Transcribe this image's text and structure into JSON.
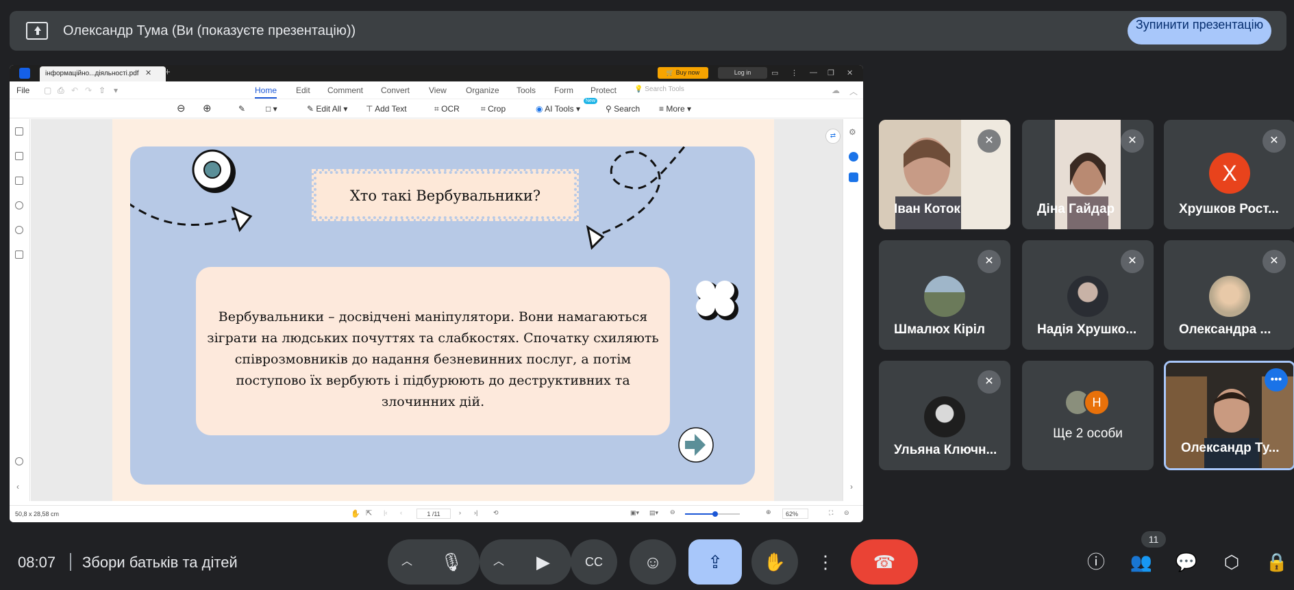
{
  "banner": {
    "title": "Олександр Тума (Ви (показуєте презентацію))",
    "stop_button": "Зупинити презентацію"
  },
  "pdf": {
    "tab_title": "інформаційно...діяльності.pdf",
    "buy_now": "Buy now",
    "log_in": "Log in",
    "file_menu": "File",
    "menu": [
      "Home",
      "Edit",
      "Comment",
      "Convert",
      "View",
      "Organize",
      "Tools",
      "Form",
      "Protect"
    ],
    "search_tools_placeholder": "Search Tools",
    "toolbar": {
      "edit_all": "Edit All",
      "add_text": "Add Text",
      "ocr": "OCR",
      "crop": "Crop",
      "ai_tools": "AI Tools",
      "search": "Search",
      "more": "More",
      "ai_badge": "New"
    },
    "status": {
      "dimensions": "50,8 x 28,58 cm",
      "page": "1 /11",
      "zoom": "62%",
      "zoom_fraction": 0.55
    },
    "slide": {
      "title": "Хто такі Вербувальники?",
      "body": "Вербувальники – досвідчені маніпулятори. Вони намагаються зіграти на людських почуттях та слабкостях. Спочатку схиляють співрозмовників до надання безневинних послуг, а потім поступово їх вербують і підбурюють до деструктивних та злочинних дій.",
      "colors": {
        "panel": "#b7c9e6",
        "page": "#fdeee1",
        "box": "#fde9dc",
        "arrow_circle": "#5b8f98"
      }
    }
  },
  "participants": [
    {
      "name": "Іван Коток",
      "type": "video",
      "muted": true
    },
    {
      "name": "Діна Гайдар",
      "type": "video",
      "muted": true
    },
    {
      "name": "Хрушков Рост...",
      "type": "letter",
      "letter": "Х",
      "color": "#e8431c",
      "muted": true
    },
    {
      "name": "Шмалюх Кіріл",
      "type": "avatar",
      "muted": true
    },
    {
      "name": "Надія Хрушко...",
      "type": "avatar",
      "muted": true
    },
    {
      "name": "Олександра ...",
      "type": "avatar",
      "muted": true
    },
    {
      "name": "Ульяна Ключн...",
      "type": "avatar",
      "muted": true
    },
    {
      "name": "Ще 2 особи",
      "type": "group",
      "letter": "Н",
      "color": "#e8710a"
    },
    {
      "name": "Олександр Ту...",
      "type": "video",
      "self": true
    }
  ],
  "bottom": {
    "time": "08:07",
    "meeting_name": "Збори батьків та дітей",
    "people_count": "11",
    "accent": "#a8c7fa",
    "end_call_color": "#ea4335"
  }
}
